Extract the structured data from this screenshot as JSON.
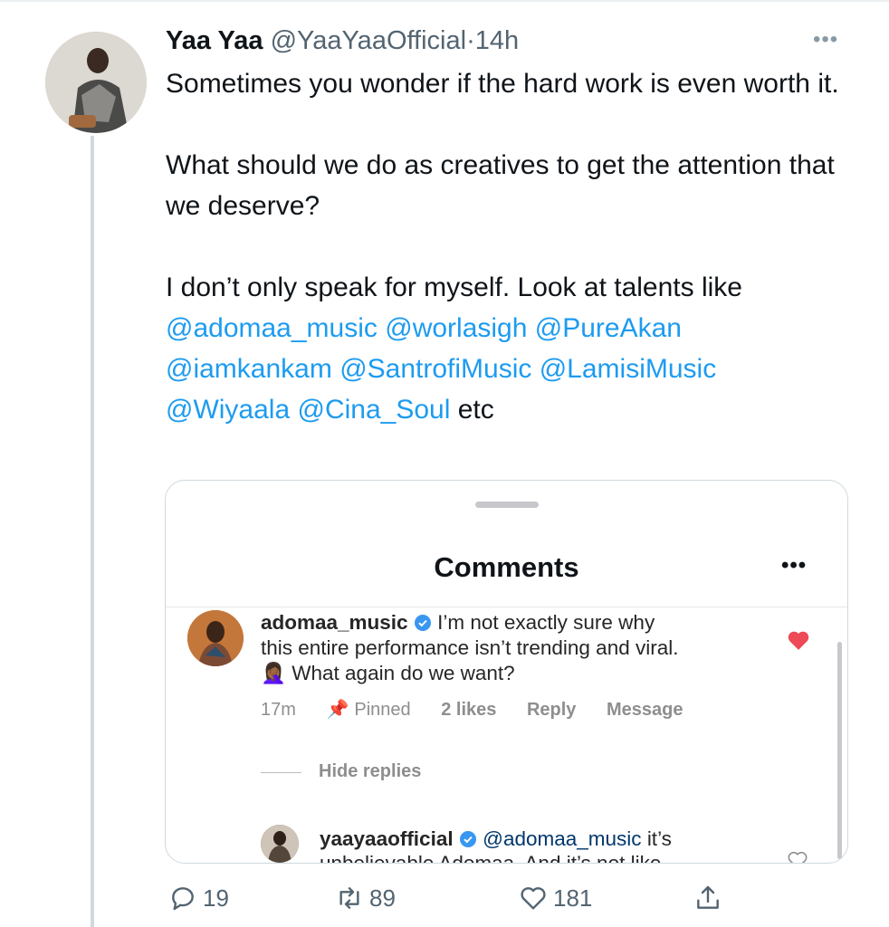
{
  "tweet": {
    "author_name": "Yaa Yaa",
    "handle": "@YaaYaaOfficial",
    "separator": "·",
    "time": "14h",
    "more_icon": "ellipsis-icon",
    "paragraph1": "Sometimes you wonder if the hard work is even worth it.",
    "paragraph2": "What should we do as creatives to get the attention that we deserve?",
    "paragraph3_text": "I don’t only speak for myself. Look at talents like",
    "mentions": [
      "@adomaa_music",
      "@worlasigh",
      "@PureAkan",
      "@iamkankam",
      "@SantrofiMusic",
      "@LamisiMusic",
      "@Wiyaala",
      "@Cina_Soul"
    ],
    "trailing": "etc"
  },
  "embedded_screenshot": {
    "title": "Comments",
    "more_icon": "ellipsis-icon",
    "comment": {
      "user": "adomaa_music",
      "text_line1": "I’m not exactly sure why",
      "text_line2": "this entire performance isn’t trending and viral.",
      "emoji": "🤦🏾‍♀️",
      "text_line3": "What again do we want?",
      "time": "17m",
      "pinned": "Pinned",
      "likes": "2 likes",
      "reply": "Reply",
      "message": "Message",
      "liked": true
    },
    "hide_replies": "Hide replies",
    "reply": {
      "user": "yaayaaofficial",
      "mention": "@adomaa_music",
      "text": "it’s",
      "text_line2_partial": "unbelievable Adomaa. And it’s not like"
    }
  },
  "actions": {
    "replies": "19",
    "retweets": "89",
    "likes": "181"
  },
  "colors": {
    "link": "#1d9bf0",
    "text": "#0f1419",
    "muted": "#536471",
    "like_red": "#ed4956",
    "verified_blue": "#3897f0"
  }
}
